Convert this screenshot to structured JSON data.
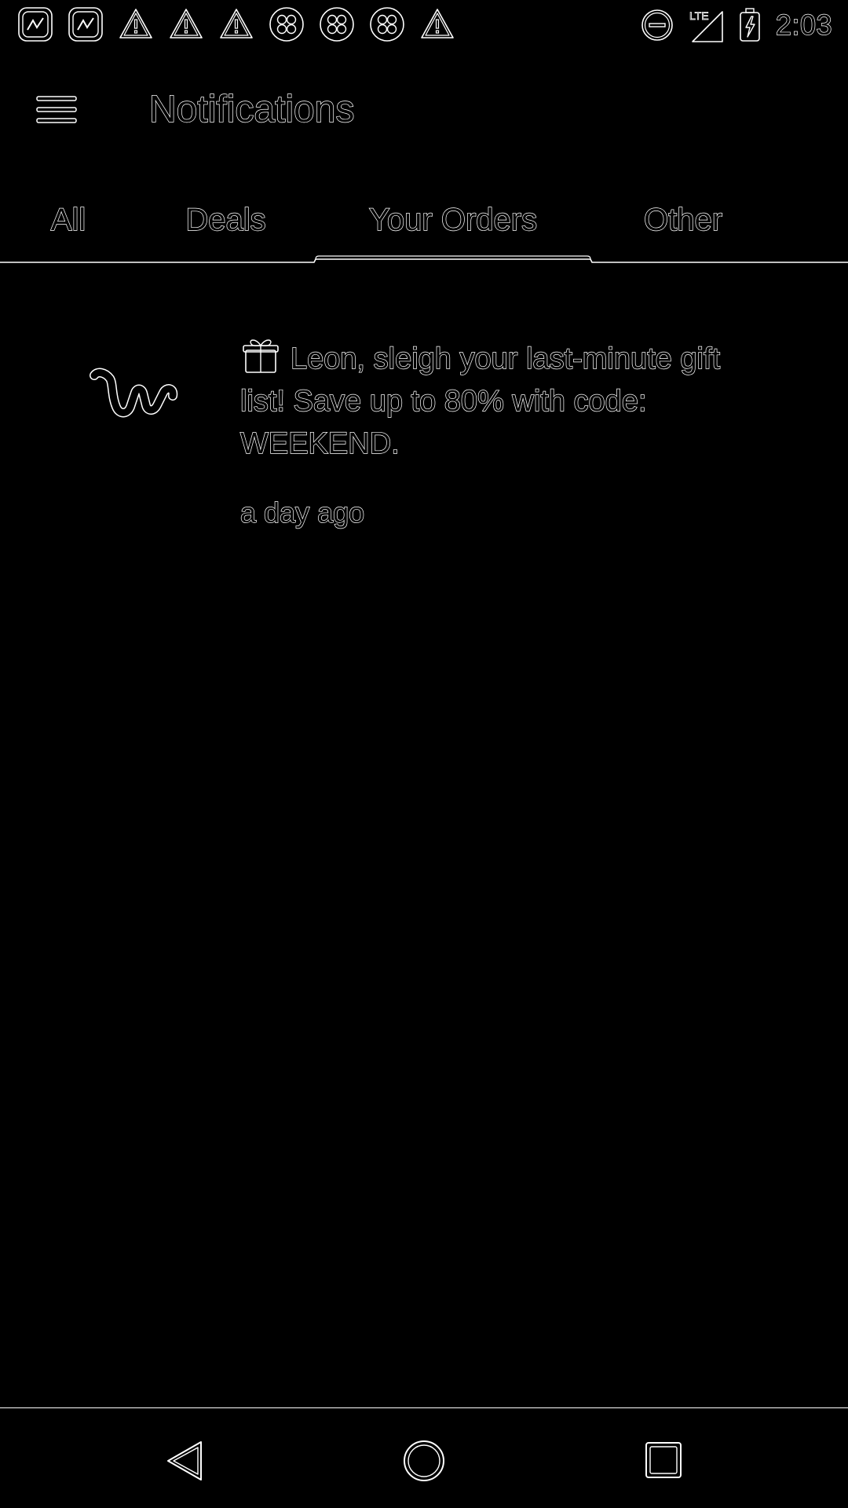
{
  "status_bar": {
    "time": "2:03",
    "network_label": "LTE",
    "left_icons": [
      "app-notification-icon",
      "app-notification-icon",
      "warning-icon",
      "warning-icon",
      "warning-icon",
      "clover-icon",
      "clover-icon",
      "clover-icon",
      "warning-icon"
    ],
    "right_icons": [
      "do-not-disturb-icon",
      "lte-signal-icon",
      "battery-charging-icon"
    ]
  },
  "header": {
    "menu_icon": "hamburger-menu-icon",
    "title": "Notifications"
  },
  "tabs": [
    {
      "label": "All",
      "selected": false
    },
    {
      "label": "Deals",
      "selected": false
    },
    {
      "label": "Your Orders",
      "selected": true
    },
    {
      "label": "Other",
      "selected": false
    }
  ],
  "notifications": [
    {
      "icon": "wish-logo-icon",
      "emoji": "gift-icon",
      "message": "Leon, sleigh your last-minute gift list! Save up to 80% with code: WEEKEND.",
      "time": "a day ago"
    }
  ],
  "nav": {
    "back_icon": "back-triangle-icon",
    "home_icon": "home-circle-icon",
    "recents_icon": "recents-square-icon"
  }
}
